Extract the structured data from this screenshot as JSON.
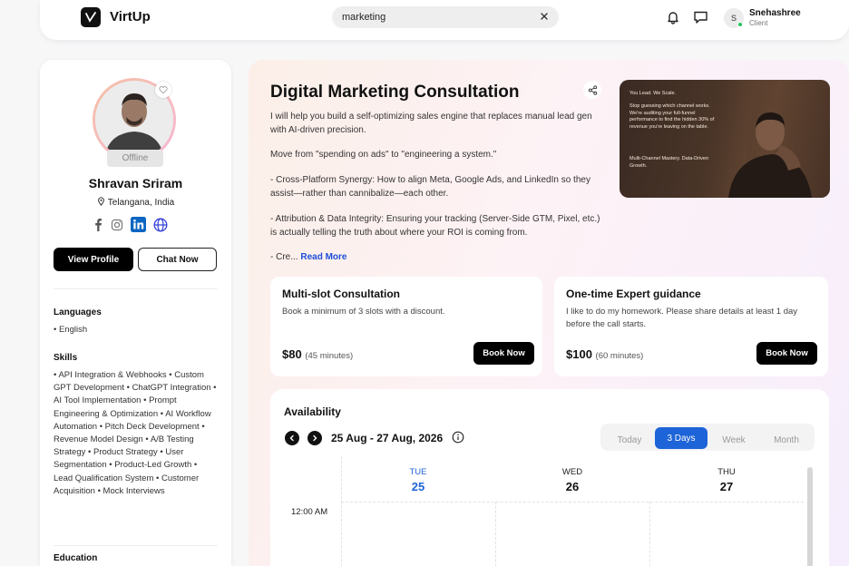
{
  "app": {
    "name": "VirtUp"
  },
  "search": {
    "value": "marketing"
  },
  "user": {
    "initial": "S",
    "name": "Snehashree",
    "role": "Client"
  },
  "profile": {
    "status": "Offline",
    "name": "Shravan Sriram",
    "location": "Telangana, India",
    "view_profile": "View Profile",
    "chat_now": "Chat Now",
    "languages_title": "Languages",
    "languages": "• English",
    "skills_title": "Skills",
    "skills": "• API Integration & Webhooks • Custom GPT Development • ChatGPT Integration • AI Tool Implementation • Prompt Engineering & Optimization • AI Workflow Automation • Pitch Deck Development • Revenue Model Design • A/B Testing Strategy • Product Strategy • User Segmentation • Product-Led Growth • Lead Qualification System • Customer Acquisition • Mock Interviews",
    "education_title": "Education"
  },
  "service": {
    "title": "Digital Marketing Consultation",
    "desc1": "I will help you build a self-optimizing sales engine that replaces manual lead gen with AI-driven precision.",
    "desc2": "Move from \"spending on ads\" to \"engineering a system.\"",
    "desc3": "- Cross-Platform Synergy: How to align Meta, Google Ads, and LinkedIn so they assist—rather than cannibalize—each other.",
    "desc4": "- Attribution & Data Integrity: Ensuring your tracking (Server-Side GTM, Pixel, etc.) is actually telling the truth about where your ROI is coming from.",
    "desc5_prefix": "- Cre...",
    "read_more": "Read More"
  },
  "video": {
    "line1": "You Lead. We Scale.",
    "line2": "Stop guessing which channel works. We're auditing your full-funnel performance to find the hidden 30% of revenue you're leaving on the table.",
    "line3": "Multi-Channel Mastery. Data-Driven Growth."
  },
  "slots": [
    {
      "title": "Multi-slot Consultation",
      "desc": "Book a minimum of 3 slots with a discount.",
      "price": "$80",
      "duration": "(45 minutes)",
      "button": "Book Now"
    },
    {
      "title": "One-time Expert guidance",
      "desc": "I like to do my homework. Please share details at least 1 day before the call starts.",
      "price": "$100",
      "duration": "(60 minutes)",
      "button": "Book Now"
    }
  ],
  "availability": {
    "title": "Availability",
    "range": "25 Aug - 27 Aug, 2026",
    "views": [
      "Today",
      "3 Days",
      "Week",
      "Month"
    ],
    "active_view": "3 Days",
    "days": [
      {
        "name": "TUE",
        "num": "25"
      },
      {
        "name": "WED",
        "num": "26"
      },
      {
        "name": "THU",
        "num": "27"
      }
    ],
    "time": "12:00 AM"
  },
  "colors": {
    "accent": "#1d64d8",
    "online": "#22c55e",
    "link": "#1d4ed8"
  }
}
